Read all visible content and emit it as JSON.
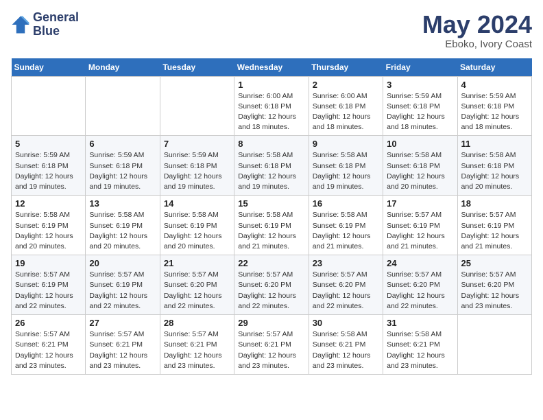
{
  "header": {
    "logo_line1": "General",
    "logo_line2": "Blue",
    "month_year": "May 2024",
    "location": "Eboko, Ivory Coast"
  },
  "days_of_week": [
    "Sunday",
    "Monday",
    "Tuesday",
    "Wednesday",
    "Thursday",
    "Friday",
    "Saturday"
  ],
  "weeks": [
    [
      {
        "day": "",
        "info": ""
      },
      {
        "day": "",
        "info": ""
      },
      {
        "day": "",
        "info": ""
      },
      {
        "day": "1",
        "info": "Sunrise: 6:00 AM\nSunset: 6:18 PM\nDaylight: 12 hours\nand 18 minutes."
      },
      {
        "day": "2",
        "info": "Sunrise: 6:00 AM\nSunset: 6:18 PM\nDaylight: 12 hours\nand 18 minutes."
      },
      {
        "day": "3",
        "info": "Sunrise: 5:59 AM\nSunset: 6:18 PM\nDaylight: 12 hours\nand 18 minutes."
      },
      {
        "day": "4",
        "info": "Sunrise: 5:59 AM\nSunset: 6:18 PM\nDaylight: 12 hours\nand 18 minutes."
      }
    ],
    [
      {
        "day": "5",
        "info": "Sunrise: 5:59 AM\nSunset: 6:18 PM\nDaylight: 12 hours\nand 19 minutes."
      },
      {
        "day": "6",
        "info": "Sunrise: 5:59 AM\nSunset: 6:18 PM\nDaylight: 12 hours\nand 19 minutes."
      },
      {
        "day": "7",
        "info": "Sunrise: 5:59 AM\nSunset: 6:18 PM\nDaylight: 12 hours\nand 19 minutes."
      },
      {
        "day": "8",
        "info": "Sunrise: 5:58 AM\nSunset: 6:18 PM\nDaylight: 12 hours\nand 19 minutes."
      },
      {
        "day": "9",
        "info": "Sunrise: 5:58 AM\nSunset: 6:18 PM\nDaylight: 12 hours\nand 19 minutes."
      },
      {
        "day": "10",
        "info": "Sunrise: 5:58 AM\nSunset: 6:18 PM\nDaylight: 12 hours\nand 20 minutes."
      },
      {
        "day": "11",
        "info": "Sunrise: 5:58 AM\nSunset: 6:18 PM\nDaylight: 12 hours\nand 20 minutes."
      }
    ],
    [
      {
        "day": "12",
        "info": "Sunrise: 5:58 AM\nSunset: 6:19 PM\nDaylight: 12 hours\nand 20 minutes."
      },
      {
        "day": "13",
        "info": "Sunrise: 5:58 AM\nSunset: 6:19 PM\nDaylight: 12 hours\nand 20 minutes."
      },
      {
        "day": "14",
        "info": "Sunrise: 5:58 AM\nSunset: 6:19 PM\nDaylight: 12 hours\nand 20 minutes."
      },
      {
        "day": "15",
        "info": "Sunrise: 5:58 AM\nSunset: 6:19 PM\nDaylight: 12 hours\nand 21 minutes."
      },
      {
        "day": "16",
        "info": "Sunrise: 5:58 AM\nSunset: 6:19 PM\nDaylight: 12 hours\nand 21 minutes."
      },
      {
        "day": "17",
        "info": "Sunrise: 5:57 AM\nSunset: 6:19 PM\nDaylight: 12 hours\nand 21 minutes."
      },
      {
        "day": "18",
        "info": "Sunrise: 5:57 AM\nSunset: 6:19 PM\nDaylight: 12 hours\nand 21 minutes."
      }
    ],
    [
      {
        "day": "19",
        "info": "Sunrise: 5:57 AM\nSunset: 6:19 PM\nDaylight: 12 hours\nand 22 minutes."
      },
      {
        "day": "20",
        "info": "Sunrise: 5:57 AM\nSunset: 6:19 PM\nDaylight: 12 hours\nand 22 minutes."
      },
      {
        "day": "21",
        "info": "Sunrise: 5:57 AM\nSunset: 6:20 PM\nDaylight: 12 hours\nand 22 minutes."
      },
      {
        "day": "22",
        "info": "Sunrise: 5:57 AM\nSunset: 6:20 PM\nDaylight: 12 hours\nand 22 minutes."
      },
      {
        "day": "23",
        "info": "Sunrise: 5:57 AM\nSunset: 6:20 PM\nDaylight: 12 hours\nand 22 minutes."
      },
      {
        "day": "24",
        "info": "Sunrise: 5:57 AM\nSunset: 6:20 PM\nDaylight: 12 hours\nand 22 minutes."
      },
      {
        "day": "25",
        "info": "Sunrise: 5:57 AM\nSunset: 6:20 PM\nDaylight: 12 hours\nand 23 minutes."
      }
    ],
    [
      {
        "day": "26",
        "info": "Sunrise: 5:57 AM\nSunset: 6:21 PM\nDaylight: 12 hours\nand 23 minutes."
      },
      {
        "day": "27",
        "info": "Sunrise: 5:57 AM\nSunset: 6:21 PM\nDaylight: 12 hours\nand 23 minutes."
      },
      {
        "day": "28",
        "info": "Sunrise: 5:57 AM\nSunset: 6:21 PM\nDaylight: 12 hours\nand 23 minutes."
      },
      {
        "day": "29",
        "info": "Sunrise: 5:57 AM\nSunset: 6:21 PM\nDaylight: 12 hours\nand 23 minutes."
      },
      {
        "day": "30",
        "info": "Sunrise: 5:58 AM\nSunset: 6:21 PM\nDaylight: 12 hours\nand 23 minutes."
      },
      {
        "day": "31",
        "info": "Sunrise: 5:58 AM\nSunset: 6:21 PM\nDaylight: 12 hours\nand 23 minutes."
      },
      {
        "day": "",
        "info": ""
      }
    ]
  ]
}
